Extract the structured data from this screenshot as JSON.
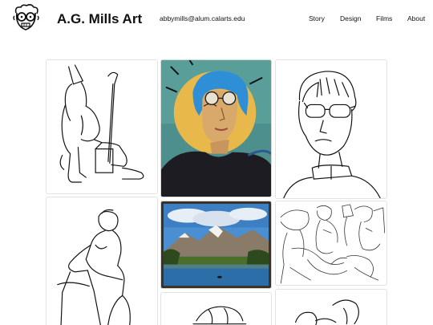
{
  "header": {
    "title": "A.G. Mills Art",
    "email": "abbymills@alum.calarts.edu",
    "logo_icon": "cartoon-face-glasses-icon"
  },
  "nav": {
    "items": [
      {
        "label": "Story"
      },
      {
        "label": "Design"
      },
      {
        "label": "Films"
      },
      {
        "label": "About"
      }
    ]
  },
  "gallery": {
    "items": [
      {
        "subject": "sketch-gnome-with-staff"
      },
      {
        "subject": "painting-self-portrait-glasses-sunflower"
      },
      {
        "subject": "sketch-portrait-glasses"
      },
      {
        "subject": "sketch-figure-leaning-on-rock"
      },
      {
        "subject": "painting-mountain-lake-landscape"
      },
      {
        "subject": "sketch-crowded-figures-scene"
      },
      {
        "subject": "sketch-partial-bottom-center"
      },
      {
        "subject": "sketch-partial-bottom-right"
      }
    ]
  },
  "colors": {
    "text": "#111111",
    "tile_border": "#e2e2e2",
    "portrait_blue_hair": "#2f8fd6",
    "portrait_yellow": "#e8b84a",
    "landscape_sky": "#4a8fd1",
    "landscape_lake": "#2c6fa8"
  }
}
